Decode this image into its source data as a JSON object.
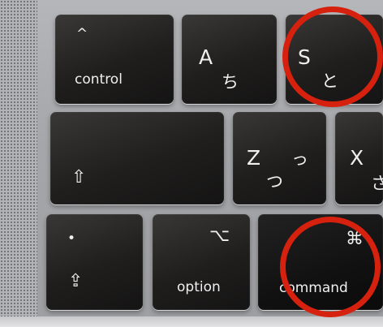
{
  "keys": {
    "control": {
      "arrow_glyph": "^",
      "label": "control"
    },
    "a": {
      "letter": "A",
      "kana": "ち"
    },
    "s": {
      "letter": "S",
      "kana": "と"
    },
    "shift": {
      "arrow_glyph": "⇧"
    },
    "z": {
      "letter": "Z",
      "kana_top": "っ",
      "kana_bottom": "つ"
    },
    "x": {
      "letter": "X",
      "kana": "さ"
    },
    "fn": {
      "dot": "•",
      "arrow_glyph": "⇪"
    },
    "option": {
      "glyph": "⌥",
      "label": "option"
    },
    "command": {
      "glyph": "⌘",
      "label": "command"
    }
  },
  "annotation_color": "#d6210f"
}
